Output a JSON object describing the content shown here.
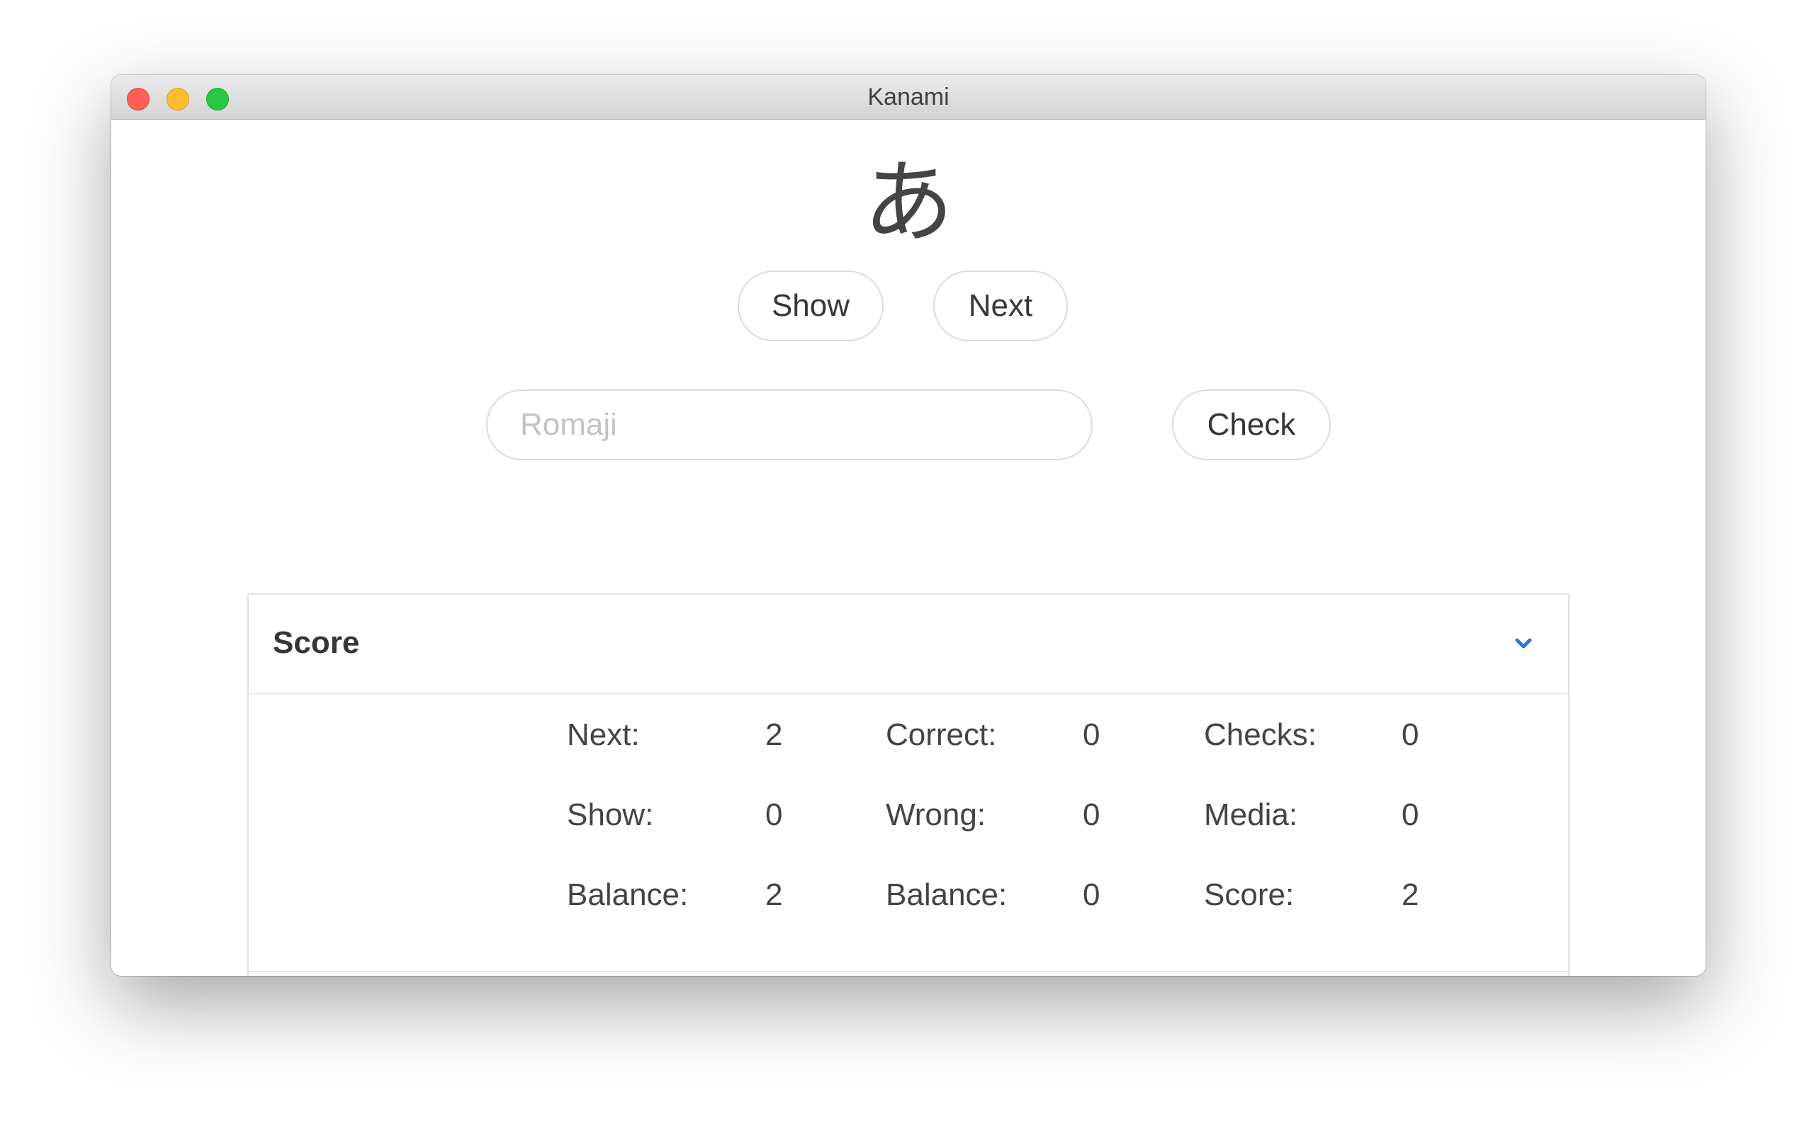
{
  "window": {
    "title": "Kanami"
  },
  "kana": {
    "character": "あ"
  },
  "controls": {
    "show_label": "Show",
    "next_label": "Next",
    "check_label": "Check",
    "romaji_placeholder": "Romaji",
    "romaji_value": ""
  },
  "score": {
    "title": "Score",
    "expand_icon": "chevron-down-icon",
    "accent_color": "#3273dc",
    "stats": [
      {
        "label": "Next:",
        "value": "2"
      },
      {
        "label": "Correct:",
        "value": "0"
      },
      {
        "label": "Checks:",
        "value": "0"
      },
      {
        "label": "Show:",
        "value": "0"
      },
      {
        "label": "Wrong:",
        "value": "0"
      },
      {
        "label": "Media:",
        "value": "0"
      },
      {
        "label": "Balance:",
        "value": "2"
      },
      {
        "label": "Balance:",
        "value": "0"
      },
      {
        "label": "Score:",
        "value": "2"
      }
    ]
  }
}
